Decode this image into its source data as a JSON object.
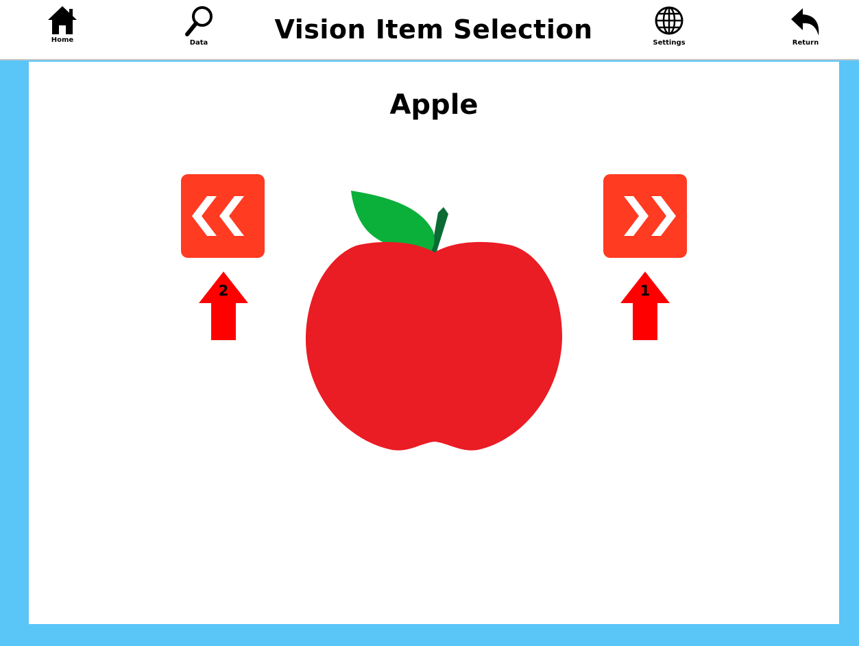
{
  "header": {
    "title": "Vision Item Selection",
    "home_label": "Home",
    "data_label": "Data",
    "settings_label": "Settings",
    "return_label": "Return"
  },
  "item": {
    "name": "Apple"
  },
  "hints": {
    "previous_number": "2",
    "next_number": "1"
  },
  "icons": {
    "home": "home-icon",
    "data": "search-icon",
    "settings": "globe-icon",
    "return": "return-arrow-icon",
    "previous": "double-chevron-left-icon",
    "next": "double-chevron-right-icon",
    "hint_arrow": "up-arrow-icon"
  },
  "colors": {
    "frame": "#5ac5f7",
    "button": "#ff3b22",
    "hint_arrow": "#ff0000",
    "apple": "#ea1c24",
    "leaf": "#0bb03a",
    "stem": "#0b6b35"
  }
}
